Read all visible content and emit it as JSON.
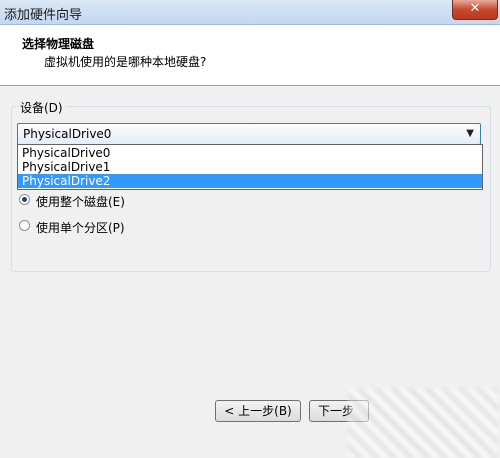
{
  "window": {
    "title": "添加硬件向导",
    "close_glyph": "✕"
  },
  "header": {
    "title": "选择物理磁盘",
    "subtitle": "虚拟机使用的是哪种本地硬盘?"
  },
  "device_group": {
    "label": "设备(D)",
    "selected_value": "PhysicalDrive0",
    "arrow_glyph": "▼",
    "options": [
      "PhysicalDrive0",
      "PhysicalDrive1",
      "PhysicalDrive2"
    ],
    "highlighted_option": "PhysicalDrive2"
  },
  "usage": {
    "options": [
      {
        "label": "使用整个磁盘(E)",
        "checked": true
      },
      {
        "label": "使用单个分区(P)",
        "checked": false
      }
    ]
  },
  "buttons": {
    "back": "< 上一步(B)",
    "next": "下一步"
  }
}
